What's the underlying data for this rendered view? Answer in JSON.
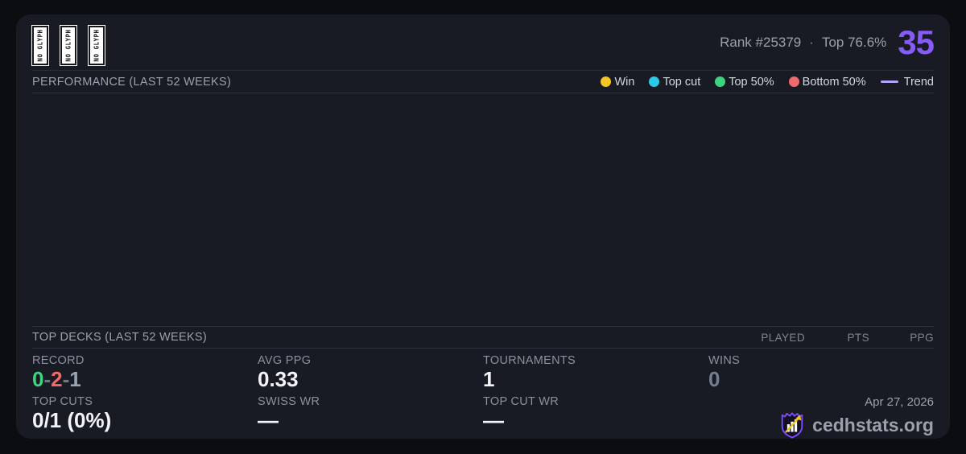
{
  "header": {
    "icons": [
      "NO GLYPH",
      "NO GLYPH",
      "NO GLYPH"
    ],
    "rank_text": "Rank #25379",
    "separator": "·",
    "top_percent": "Top 76.6%",
    "score": "35"
  },
  "performance": {
    "title": "PERFORMANCE (LAST 52 WEEKS)",
    "legend": [
      {
        "label": "Win",
        "color": "#f2c522",
        "type": "dot"
      },
      {
        "label": "Top cut",
        "color": "#2cc9e8",
        "type": "dot"
      },
      {
        "label": "Top 50%",
        "color": "#3ed47f",
        "type": "dot"
      },
      {
        "label": "Bottom 50%",
        "color": "#ef6a6a",
        "type": "dot"
      },
      {
        "label": "Trend",
        "color": "#b3a2f7",
        "type": "line"
      }
    ],
    "chart_empty": true
  },
  "top_decks": {
    "title": "TOP DECKS (LAST 52 WEEKS)",
    "columns": [
      "PLAYED",
      "PTS",
      "PPG"
    ],
    "rows": []
  },
  "stats": {
    "record": {
      "label": "RECORD",
      "wins": "0",
      "losses": "2",
      "draws": "1",
      "separator": "-"
    },
    "avg_ppg": {
      "label": "AVG PPG",
      "value": "0.33"
    },
    "tournaments": {
      "label": "TOURNAMENTS",
      "value": "1"
    },
    "wins": {
      "label": "WINS",
      "value": "0"
    },
    "top_cuts": {
      "label": "TOP CUTS",
      "value": "0/1 (0%)"
    },
    "swiss_wr": {
      "label": "SWISS WR",
      "value": "—"
    },
    "top_cut_wr": {
      "label": "TOP CUT WR",
      "value": "—"
    }
  },
  "footer": {
    "date": "Apr 27, 2026",
    "site": "cedhstats.org"
  },
  "colors": {
    "accent_purple": "#875cf6",
    "card_bg": "#181b24",
    "page_bg": "#0c0d11",
    "win": "#f2c522",
    "top_cut": "#2cc9e8",
    "top_50": "#3ed47f",
    "bottom_50": "#ef6a6a",
    "trend": "#b3a2f7"
  }
}
